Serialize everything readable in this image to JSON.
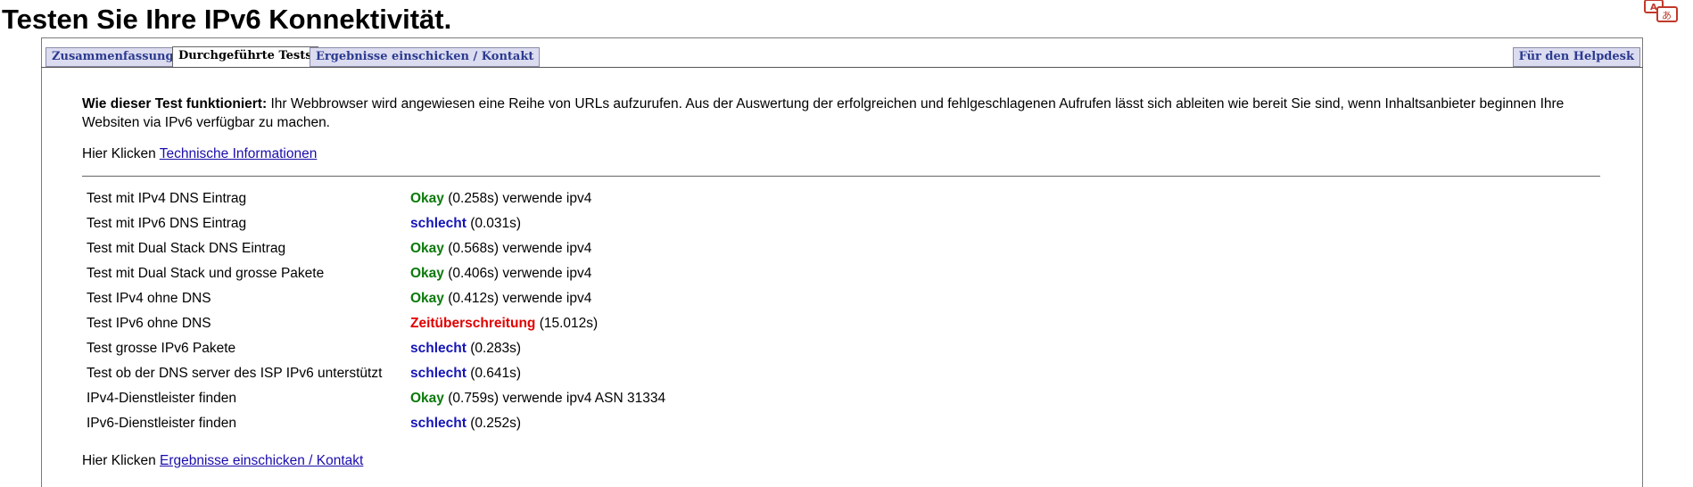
{
  "page": {
    "title": "Testen Sie Ihre IPv6 Konnektivität."
  },
  "tabs": {
    "summary": "Zusammenfassung",
    "tests": "Durchgeführte Tests",
    "submit": "Ergebnisse einschicken / Kontakt",
    "helpdesk": "Für den Helpdesk",
    "active": "tests"
  },
  "howto": {
    "label": "Wie dieser Test funktioniert:",
    "text": " Ihr Webbrowser wird angewiesen eine Reihe von URLs aufzurufen. Aus der Auswertung der erfolgreichen und fehlgeschlagenen Aufrufen lässt sich ableiten wie bereit Sie sind, wenn Inhaltsanbieter beginnen Ihre Websiten via IPv6 verfügbar zu machen."
  },
  "tech_link": {
    "prefix": "Hier Klicken ",
    "link": "Technische Informationen"
  },
  "results": [
    {
      "name": "Test mit IPv4 DNS Eintrag",
      "status": "Okay",
      "kind": "ok",
      "detail": " (0.258s) verwende ipv4"
    },
    {
      "name": "Test mit IPv6 DNS Eintrag",
      "status": "schlecht",
      "kind": "bad",
      "detail": " (0.031s)"
    },
    {
      "name": "Test mit Dual Stack DNS Eintrag",
      "status": "Okay",
      "kind": "ok",
      "detail": " (0.568s) verwende ipv4"
    },
    {
      "name": "Test mit Dual Stack und grosse Pakete",
      "status": "Okay",
      "kind": "ok",
      "detail": " (0.406s) verwende ipv4"
    },
    {
      "name": "Test IPv4 ohne DNS",
      "status": "Okay",
      "kind": "ok",
      "detail": " (0.412s) verwende ipv4"
    },
    {
      "name": "Test IPv6 ohne DNS",
      "status": "Zeitüberschreitung",
      "kind": "timeout",
      "detail": " (15.012s)"
    },
    {
      "name": "Test grosse IPv6 Pakete",
      "status": "schlecht",
      "kind": "bad",
      "detail": " (0.283s)"
    },
    {
      "name": "Test ob der DNS server des ISP IPv6 unterstützt",
      "status": "schlecht",
      "kind": "bad",
      "detail": " (0.641s)"
    },
    {
      "name": "IPv4-Dienstleister finden",
      "status": "Okay",
      "kind": "ok",
      "detail": " (0.759s) verwende ipv4 ASN 31334"
    },
    {
      "name": "IPv6-Dienstleister finden",
      "status": "schlecht",
      "kind": "bad",
      "detail": " (0.252s)"
    }
  ],
  "submit_link": {
    "prefix": "Hier Klicken ",
    "link": "Ergebnisse einschicken / Kontakt"
  },
  "colors": {
    "ok": "#0a7a0a",
    "bad": "#1515b8",
    "timeout": "#e00000",
    "link": "#1a0dab",
    "tab_bg": "#dcdcf0"
  },
  "icons": {
    "translate": "translate-icon"
  }
}
